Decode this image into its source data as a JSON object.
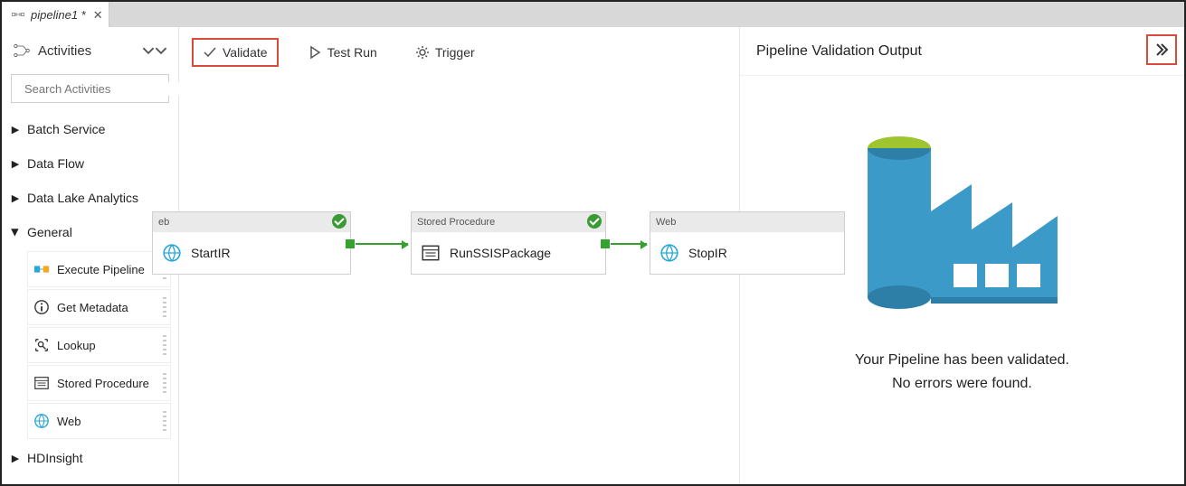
{
  "tab": {
    "title": "pipeline1 *"
  },
  "sidebar": {
    "heading": "Activities",
    "search_placeholder": "Search Activities",
    "categories": [
      {
        "label": "Batch Service",
        "expanded": false
      },
      {
        "label": "Data Flow",
        "expanded": false
      },
      {
        "label": "Data Lake Analytics",
        "expanded": false
      },
      {
        "label": "General",
        "expanded": true
      },
      {
        "label": "HDInsight",
        "expanded": false
      }
    ],
    "general_items": [
      {
        "label": "Execute Pipeline",
        "icon": "execute-pipeline-icon"
      },
      {
        "label": "Get Metadata",
        "icon": "info-circle-icon"
      },
      {
        "label": "Lookup",
        "icon": "lookup-icon"
      },
      {
        "label": "Stored Procedure",
        "icon": "stored-procedure-icon"
      },
      {
        "label": "Web",
        "icon": "globe-icon"
      }
    ]
  },
  "toolbar": {
    "validate_label": "Validate",
    "testrun_label": "Test Run",
    "trigger_label": "Trigger"
  },
  "canvas": {
    "activities": [
      {
        "type_label": "eb",
        "name": "StartIR",
        "icon": "globe-icon",
        "status": "success"
      },
      {
        "type_label": "Stored Procedure",
        "name": "RunSSISPackage",
        "icon": "stored-procedure-icon",
        "status": "success"
      },
      {
        "type_label": "Web",
        "name": "StopIR",
        "icon": "globe-icon",
        "status": "none"
      }
    ]
  },
  "validation_panel": {
    "title": "Pipeline Validation Output",
    "message_line1": "Your Pipeline has been validated.",
    "message_line2": "No errors were found."
  },
  "colors": {
    "highlight": "#d84a3a",
    "success": "#35a22f",
    "factory_blue": "#3c9ac9",
    "factory_green": "#9ec52e"
  }
}
